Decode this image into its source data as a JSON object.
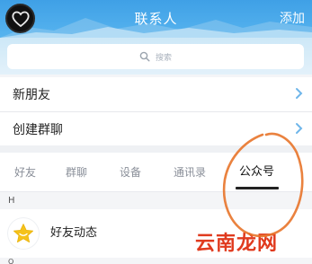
{
  "header": {
    "title": "联系人",
    "add_label": "添加"
  },
  "search": {
    "placeholder": "搜索"
  },
  "rows": [
    {
      "label": "新朋友"
    },
    {
      "label": "创建群聊"
    }
  ],
  "tabs": [
    {
      "label": "好友",
      "active": false
    },
    {
      "label": "群聊",
      "active": false
    },
    {
      "label": "设备",
      "active": false
    },
    {
      "label": "通讯录",
      "active": false
    },
    {
      "label": "公众号",
      "active": true
    }
  ],
  "section": {
    "letter": "H",
    "next_letter": "Q"
  },
  "contacts": [
    {
      "name": "好友动态",
      "icon": "star-icon"
    }
  ],
  "watermark": {
    "text": "云南龙网"
  },
  "colors": {
    "header_blue": "#3fa0e6",
    "annotation_orange": "#e8742a",
    "watermark_red": "#e03a1e",
    "star_yellow": "#f5c21b",
    "chevron_blue": "#6fb6ea"
  }
}
